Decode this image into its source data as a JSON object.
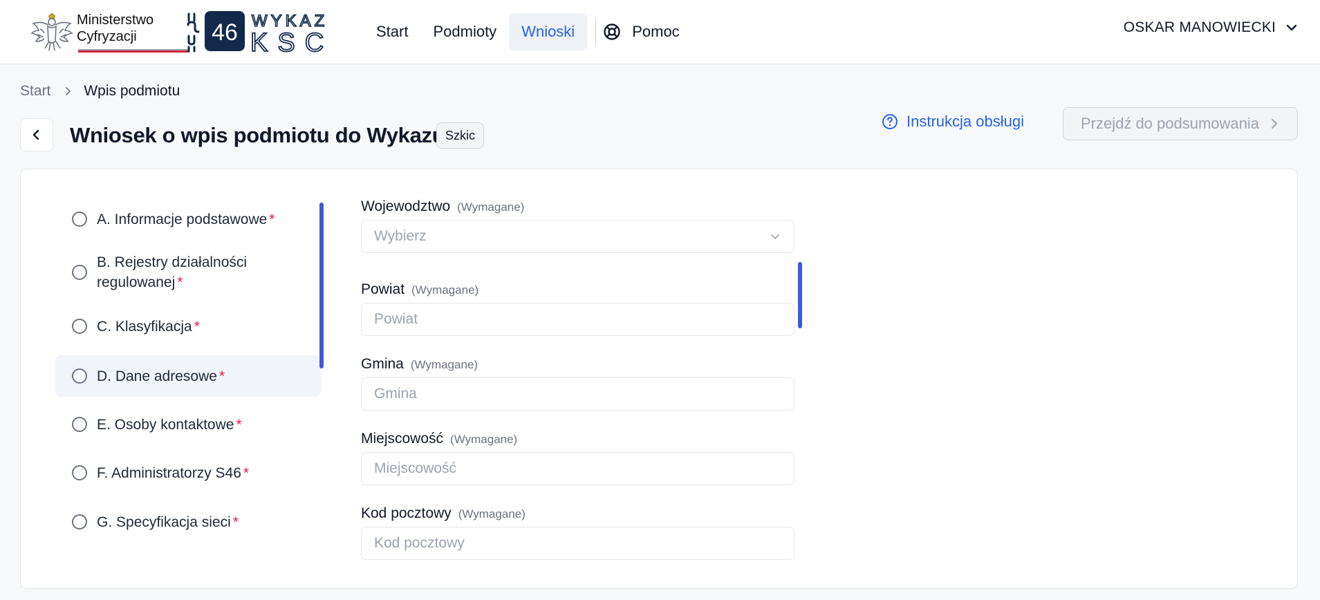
{
  "header": {
    "ministry_line1": "Ministerstwo",
    "ministry_line2": "Cyfryzacji",
    "logo_number": "46",
    "logo_word_top": "WYKAZ",
    "logo_word_bottom": "KSC",
    "nav": [
      {
        "label": "Start",
        "active": false
      },
      {
        "label": "Podmioty",
        "active": false
      },
      {
        "label": "Wnioski",
        "active": true
      }
    ],
    "help_label": "Pomoc",
    "user_name": "OSKAR MANOWIECKI"
  },
  "breadcrumb": {
    "items": [
      "Start",
      "Wpis podmiotu"
    ]
  },
  "page": {
    "title": "Wniosek o wpis podmiotu do Wykazu",
    "status_badge": "Szkic",
    "manual_link": "Instrukcja obsługi",
    "summary_button": "Przejdź do podsumowania"
  },
  "steps": [
    {
      "line1": "A. Informacje podstawowe",
      "line2": "",
      "required": "*",
      "active": false
    },
    {
      "line1": "B. Rejestry działalności",
      "line2": "regulowanej",
      "required": "*",
      "active": false
    },
    {
      "line1": "C. Klasyfikacja",
      "line2": "",
      "required": "*",
      "active": false
    },
    {
      "line1": "D. Dane adresowe",
      "line2": "",
      "required": "*",
      "active": true
    },
    {
      "line1": "E. Osoby kontaktowe",
      "line2": "",
      "required": "*",
      "active": false
    },
    {
      "line1": "F. Administratorzy S46",
      "line2": "",
      "required": "*",
      "active": false
    },
    {
      "line1": "G. Specyfikacja sieci",
      "line2": "",
      "required": "*",
      "active": false
    }
  ],
  "form": {
    "fields": [
      {
        "label": "Wojewodztwo",
        "hint": "(Wymagane)",
        "placeholder": "Wybierz",
        "type": "select"
      },
      {
        "label": "Powiat",
        "hint": "(Wymagane)",
        "placeholder": "Powiat",
        "type": "text"
      },
      {
        "label": "Gmina",
        "hint": "(Wymagane)",
        "placeholder": "Gmina",
        "type": "text"
      },
      {
        "label": "Miejscowość",
        "hint": "(Wymagane)",
        "placeholder": "Miejscowość",
        "type": "text"
      },
      {
        "label": "Kod pocztowy",
        "hint": "(Wymagane)",
        "placeholder": "Kod pocztowy",
        "type": "text"
      }
    ]
  },
  "colors": {
    "accent": "#2563eb",
    "scrollbar": "#3b5bdb",
    "required": "#e11d48",
    "ministry_red": "#d4213d",
    "logo_navy": "#13294b"
  }
}
